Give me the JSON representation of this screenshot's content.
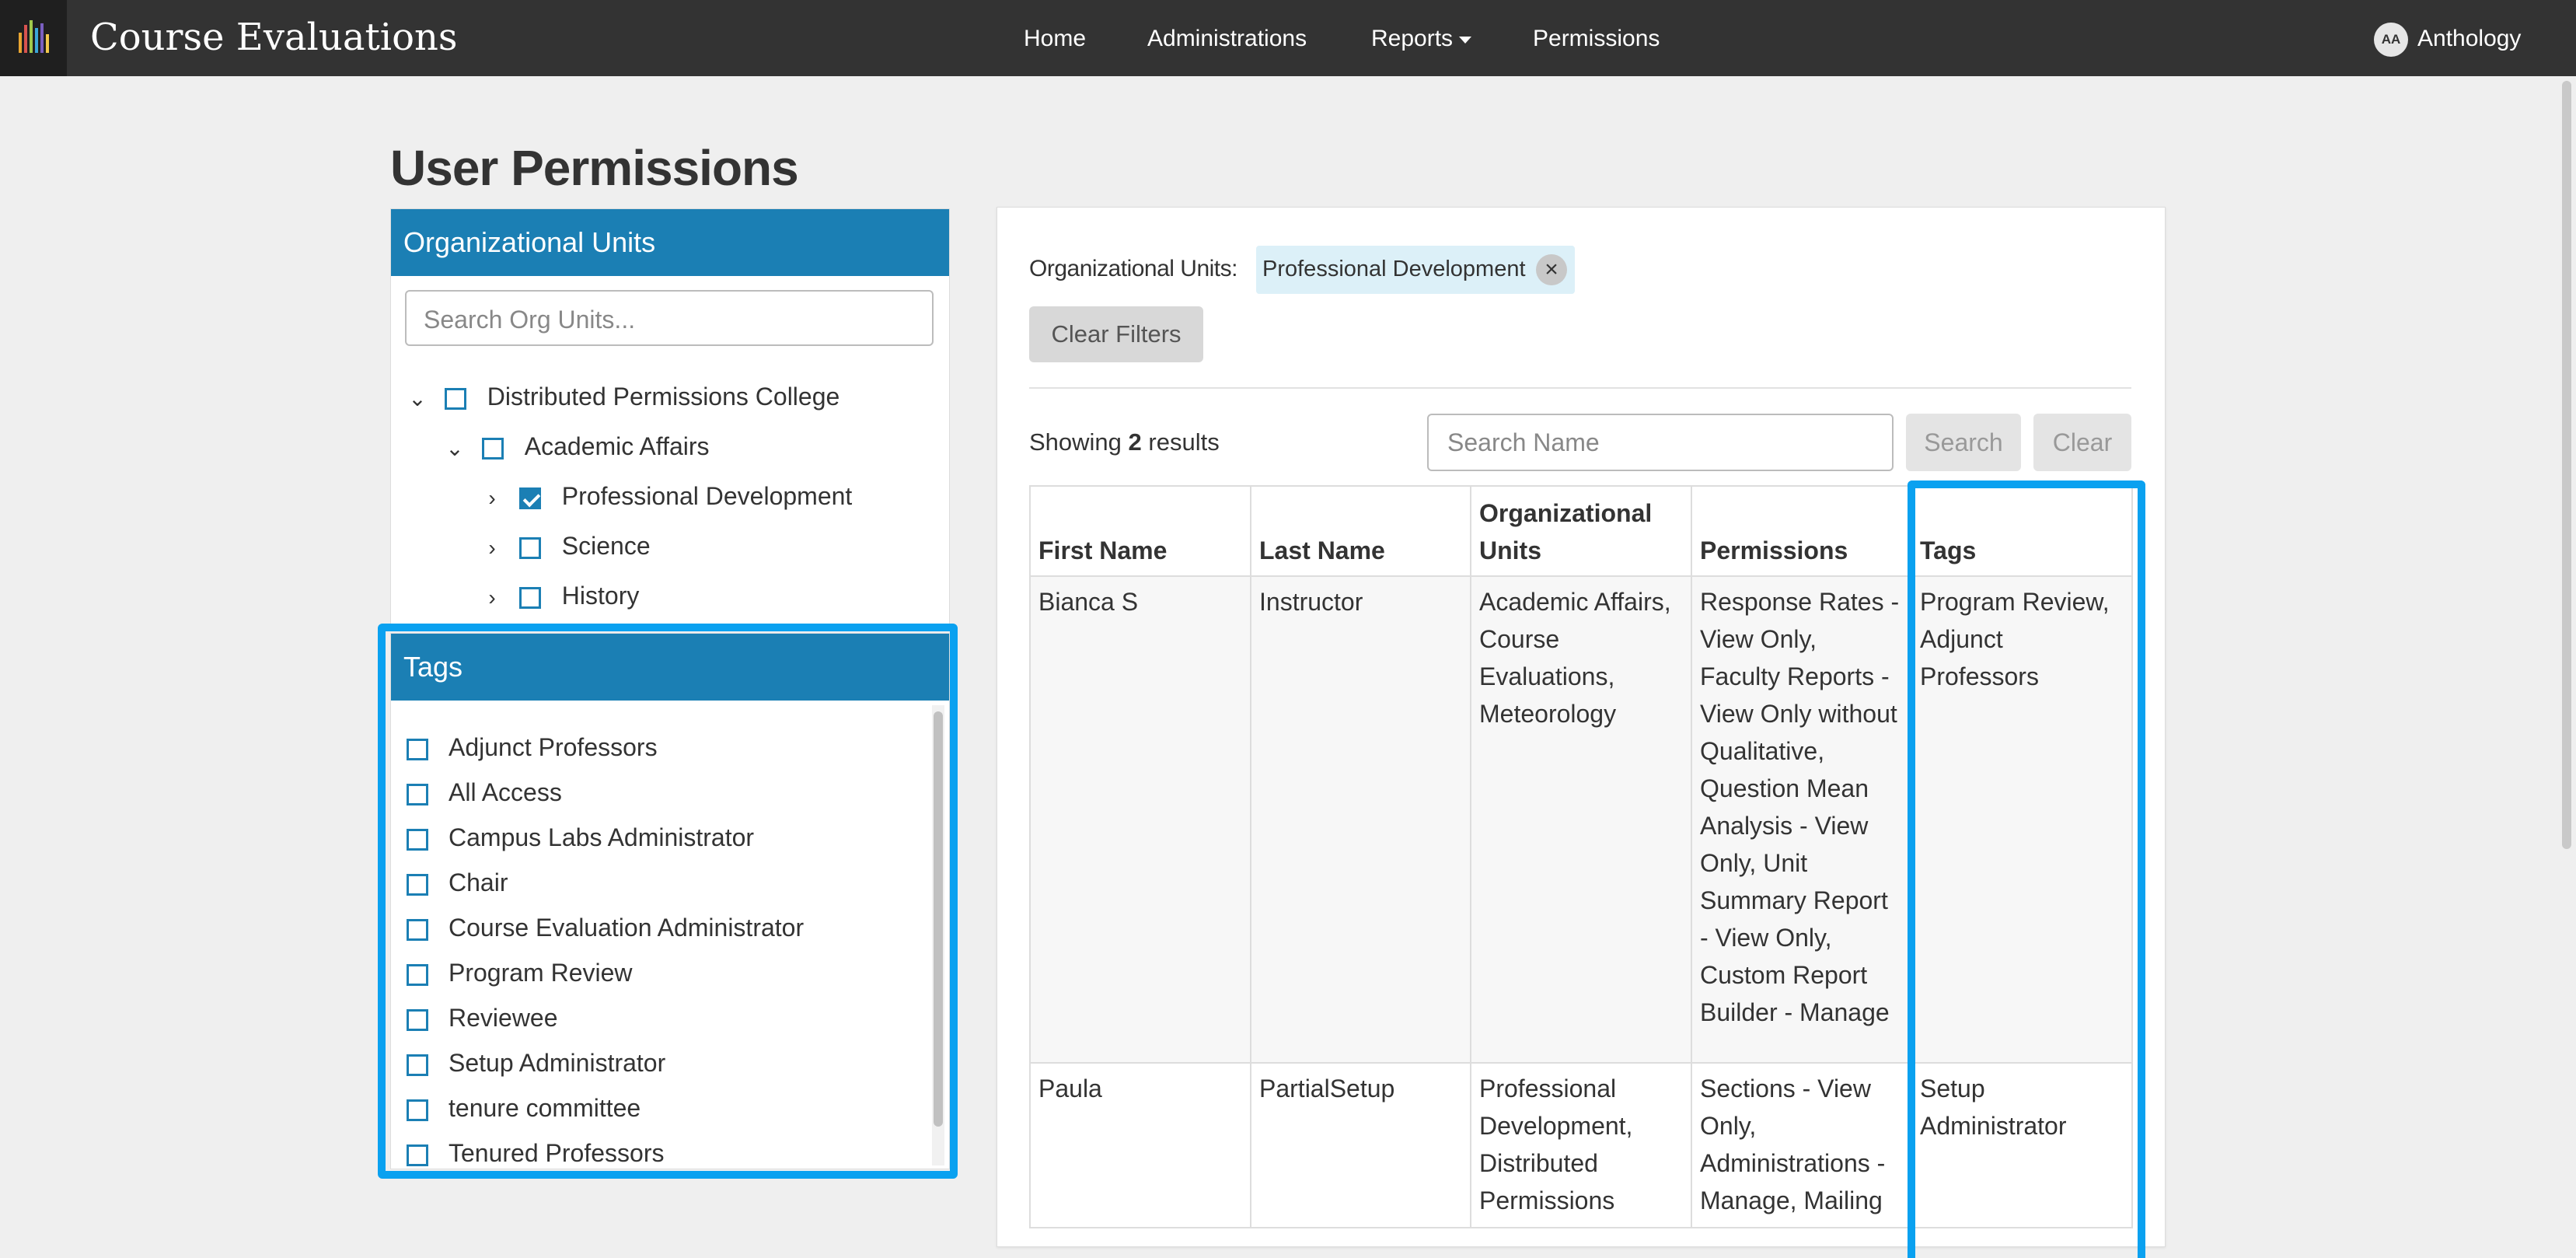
{
  "header": {
    "brand": "Course Evaluations",
    "nav": {
      "home": "Home",
      "administrations": "Administrations",
      "reports": "Reports",
      "permissions": "Permissions"
    },
    "user": {
      "initials": "AA",
      "name": "Anthology"
    }
  },
  "page": {
    "title": "User Permissions"
  },
  "org_units": {
    "title": "Organizational Units",
    "search_placeholder": "Search Org Units...",
    "tree": [
      {
        "label": "Distributed Permissions College",
        "checked": false,
        "expanded": true
      },
      {
        "label": "Academic Affairs",
        "checked": false,
        "expanded": true
      },
      {
        "label": "Professional Development",
        "checked": true,
        "expanded": false
      },
      {
        "label": "Science",
        "checked": false,
        "expanded": false
      },
      {
        "label": "History",
        "checked": false,
        "expanded": false
      }
    ]
  },
  "tags": {
    "title": "Tags",
    "items": [
      "Adjunct Professors",
      "All Access",
      "Campus Labs Administrator",
      "Chair",
      "Course Evaluation Administrator",
      "Program Review",
      "Reviewee",
      "Setup Administrator",
      "tenure committee",
      "Tenured Professors"
    ]
  },
  "filters": {
    "label": "Organizational Units:",
    "chip": "Professional Development",
    "clear_filters": "Clear Filters"
  },
  "results": {
    "showing_prefix": "Showing",
    "count": "2",
    "showing_suffix": "results",
    "search_placeholder": "Search Name",
    "search_button": "Search",
    "clear_button": "Clear"
  },
  "table": {
    "headers": [
      "First Name",
      "Last Name",
      "Organizational Units",
      "Permissions",
      "Tags"
    ],
    "rows": [
      {
        "first_name": "Bianca S",
        "last_name": "Instructor",
        "org_units": "Academic Affairs, Course Evaluations, Meteorology",
        "permissions": "Response Rates - View Only, Faculty Reports - View Only without Qualitative, Question Mean Analysis - View Only, Unit Summary Report - View Only, Custom Report Builder - Manage",
        "tags": "Program Review, Adjunct Professors"
      },
      {
        "first_name": "Paula",
        "last_name": "PartialSetup",
        "org_units": "Professional Development, Distributed Permissions",
        "permissions": "Sections - View Only, Administrations - Manage, Mailing",
        "tags": "Setup Administrator"
      }
    ]
  },
  "colors": {
    "topbar": "#333333",
    "panel_header": "#1b7fb4",
    "highlight": "#0aa1f0",
    "chip_bg": "#dcf0f8"
  }
}
